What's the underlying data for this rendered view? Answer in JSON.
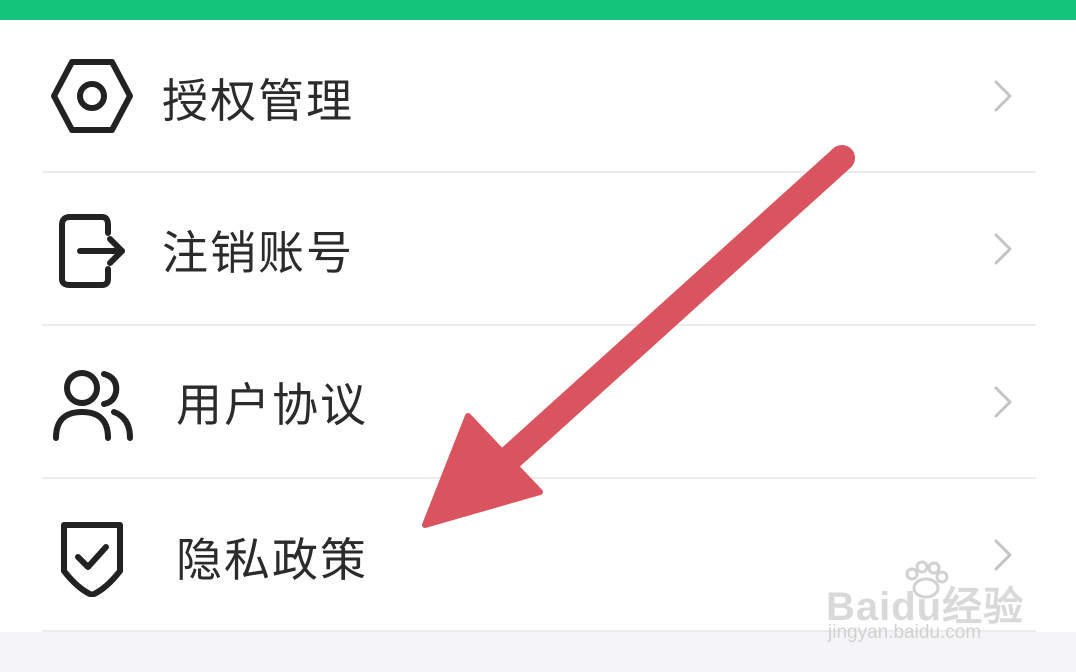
{
  "header": {
    "accent_color": "#13c47a"
  },
  "menu": {
    "items": [
      {
        "label": "授权管理",
        "icon": "hexagon-settings-icon"
      },
      {
        "label": "注销账号",
        "icon": "logout-icon"
      },
      {
        "label": "用户协议",
        "icon": "users-icon"
      },
      {
        "label": "隐私政策",
        "icon": "shield-check-icon"
      }
    ],
    "chevron_icon": "chevron-right-icon"
  },
  "annotation": {
    "arrow_color": "#d9545e",
    "arrow_icon": "red-arrow-annotation"
  },
  "watermark": {
    "logo_text": "Baidu经验",
    "url": "jingyan.baidu.com"
  }
}
